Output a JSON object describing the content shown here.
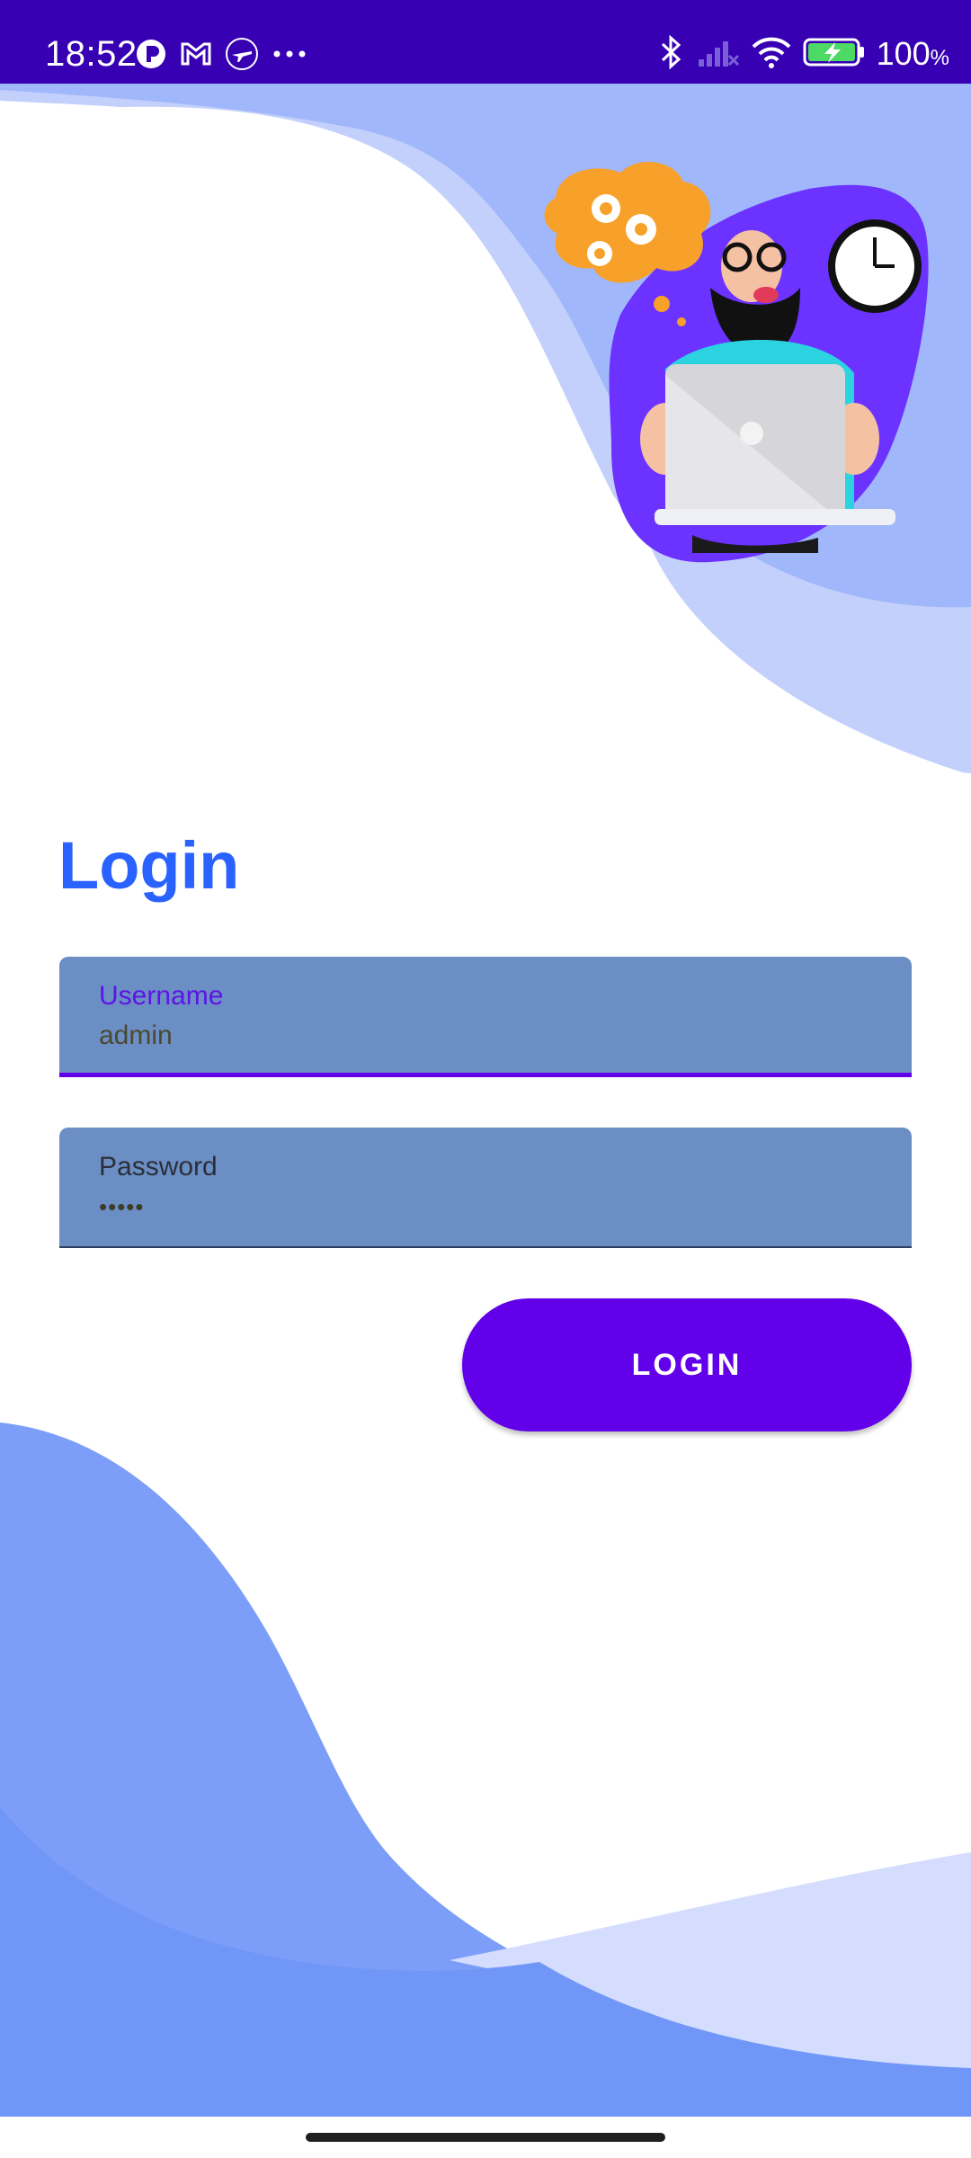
{
  "status_bar": {
    "time": "18:52",
    "battery_percent": "100",
    "battery_unit": "%",
    "left_icons": [
      "r-badge-icon",
      "gmail-icon",
      "airplane-app-icon",
      "more-dots-icon"
    ],
    "right_icons": [
      "bluetooth-icon",
      "no-signal-icon",
      "wifi-icon",
      "battery-charging-icon"
    ]
  },
  "login": {
    "title": "Login",
    "username": {
      "label": "Username",
      "value": "admin"
    },
    "password": {
      "label": "Password",
      "value": "•••••"
    },
    "button_label": "LOGIN"
  },
  "colors": {
    "status_bar": "#3700b3",
    "accent": "#6200ea",
    "title": "#2962ff",
    "field_fill": "#6b8ec4",
    "wave_light": "#c3d0fb",
    "wave_mid": "#a1b7fb",
    "wave_dark": "#7090f8"
  }
}
